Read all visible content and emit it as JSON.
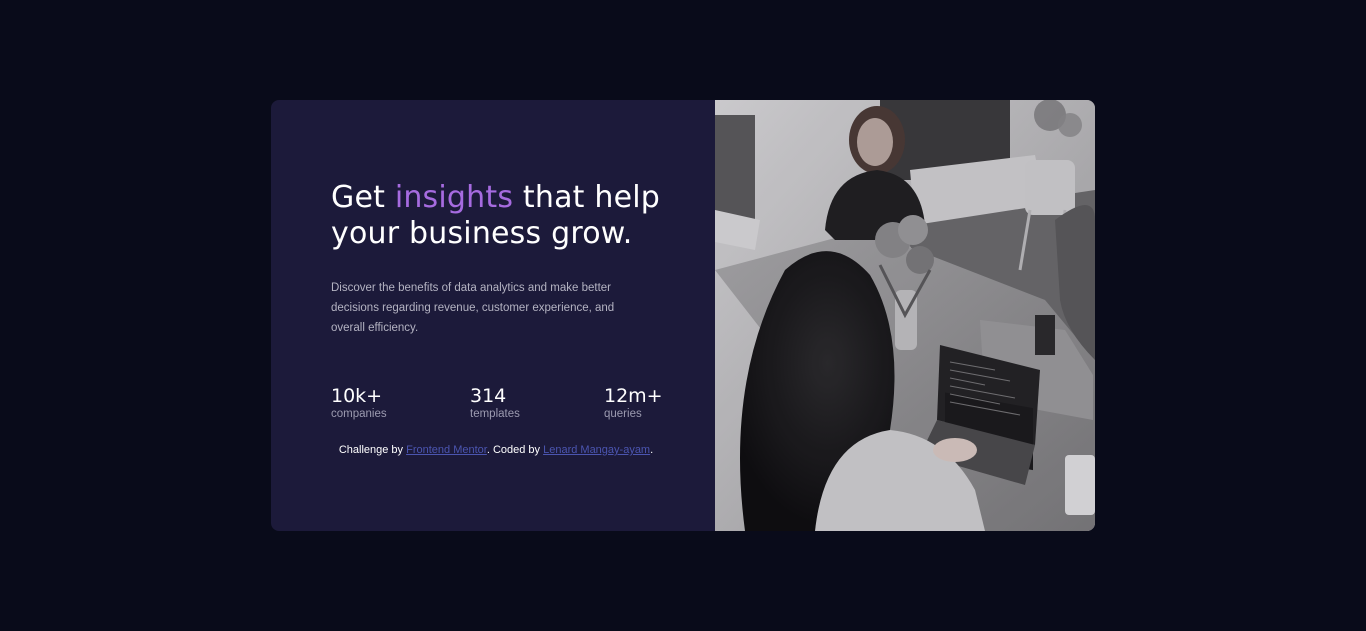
{
  "hero": {
    "title_part1": "Get ",
    "title_accent": "insights",
    "title_part2": " that help your business grow.",
    "description": "Discover the benefits of data analytics and make better decisions regarding revenue, customer experience, and overall efficiency."
  },
  "stats": [
    {
      "value": "10k+",
      "label": "companies"
    },
    {
      "value": "314",
      "label": "templates"
    },
    {
      "value": "12m+",
      "label": "queries"
    }
  ],
  "attribution": {
    "prefix": "Challenge by ",
    "link1": "Frontend Mentor",
    "middle": ". Coded by ",
    "link2": "Lenard Mangay-ayam",
    "suffix": "."
  },
  "image": {
    "alt": "people working at a table with laptops",
    "icon": "photo-image"
  },
  "colors": {
    "page_background": "#090b1a",
    "card_background": "#1c1a3a",
    "accent": "#a66be0",
    "link": "#4b55b0"
  }
}
